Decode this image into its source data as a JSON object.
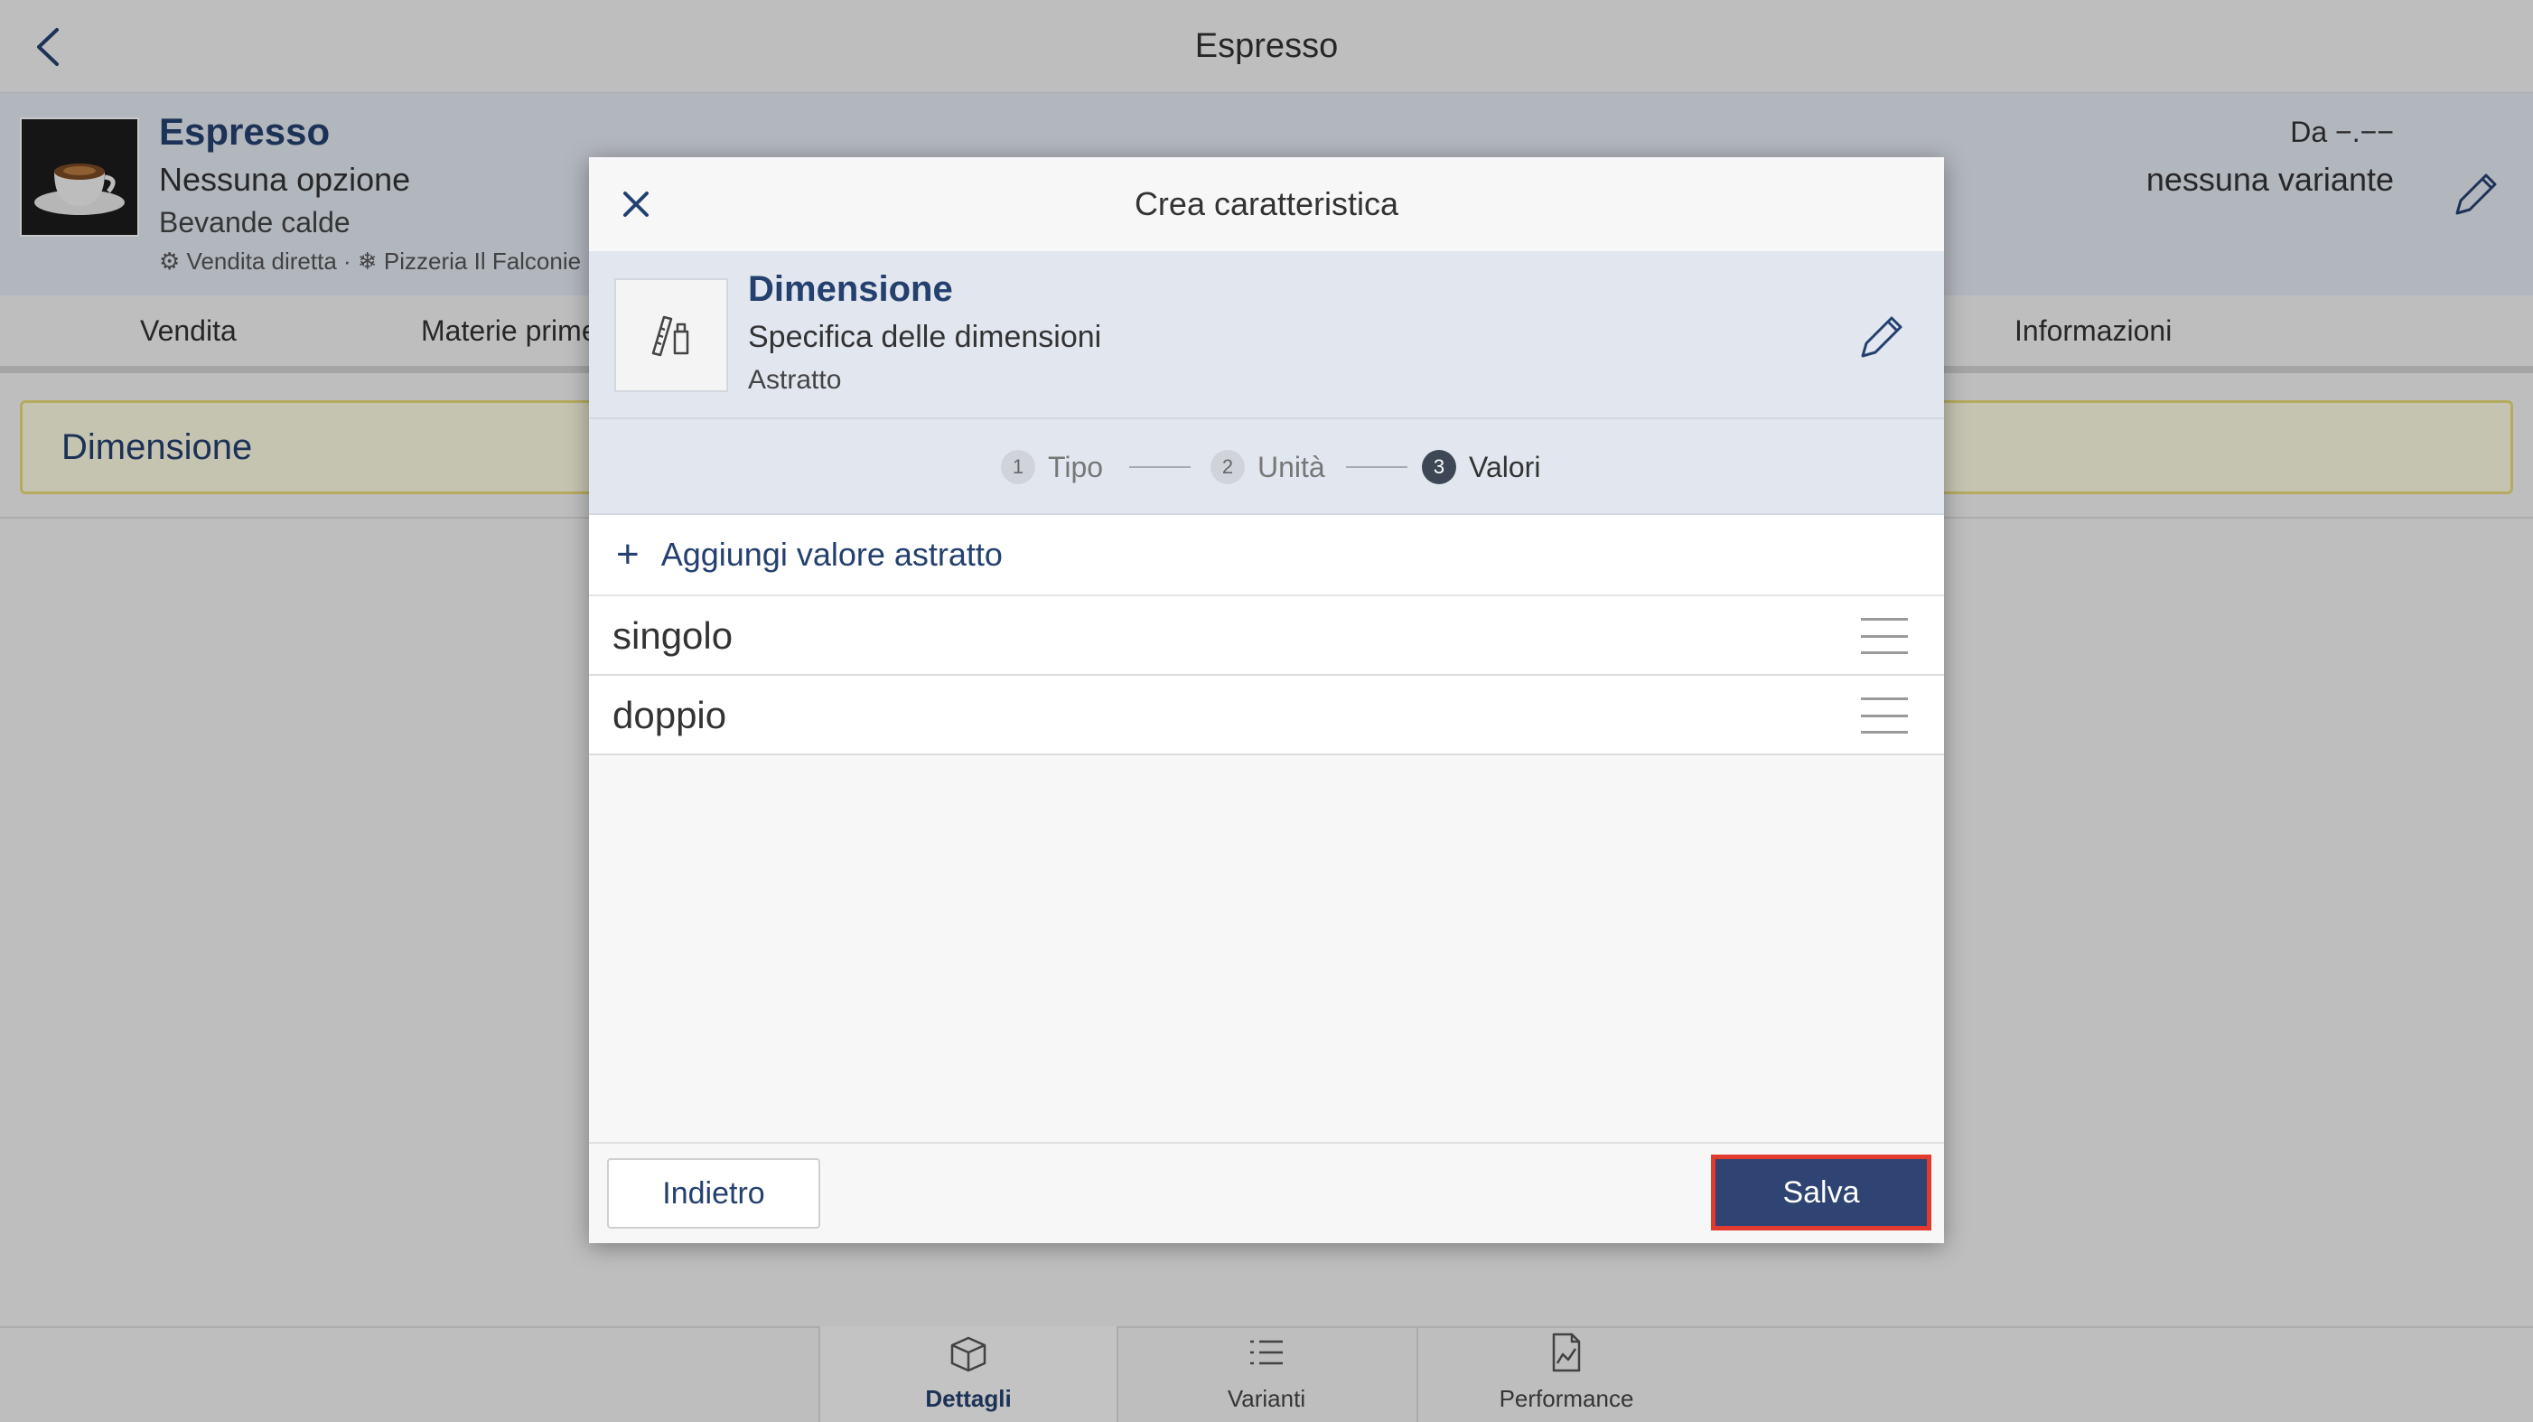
{
  "topbar": {
    "title": "Espresso"
  },
  "product": {
    "name": "Espresso",
    "option": "Nessuna opzione",
    "category": "Bevande calde",
    "meta": "Vendita diretta · ❄ Pizzeria Il Falconie",
    "price": "Da −.−−",
    "variants": "nessuna variante"
  },
  "tabs": [
    "Vendita",
    "Materie prime",
    "Informazioni"
  ],
  "section": {
    "title": "Dimensione"
  },
  "dialog": {
    "title": "Crea caratteristica",
    "summary": {
      "name": "Dimensione",
      "description": "Specifica delle dimensioni",
      "type": "Astratto"
    },
    "steps": [
      {
        "num": "1",
        "label": "Tipo"
      },
      {
        "num": "2",
        "label": "Unità"
      },
      {
        "num": "3",
        "label": "Valori"
      }
    ],
    "add_label": "Aggiungi valore astratto",
    "values": [
      "singolo",
      "doppio"
    ],
    "back_label": "Indietro",
    "save_label": "Salva"
  },
  "bottom_nav": [
    {
      "label": "Dettagli",
      "icon": "box-icon"
    },
    {
      "label": "Varianti",
      "icon": "list-icon"
    },
    {
      "label": "Performance",
      "icon": "chart-doc-icon"
    }
  ],
  "colors": {
    "accent": "#24406f",
    "save_button": "#2f4472",
    "highlight_border": "#e23a2d",
    "section_bg": "#fdfbe3"
  }
}
